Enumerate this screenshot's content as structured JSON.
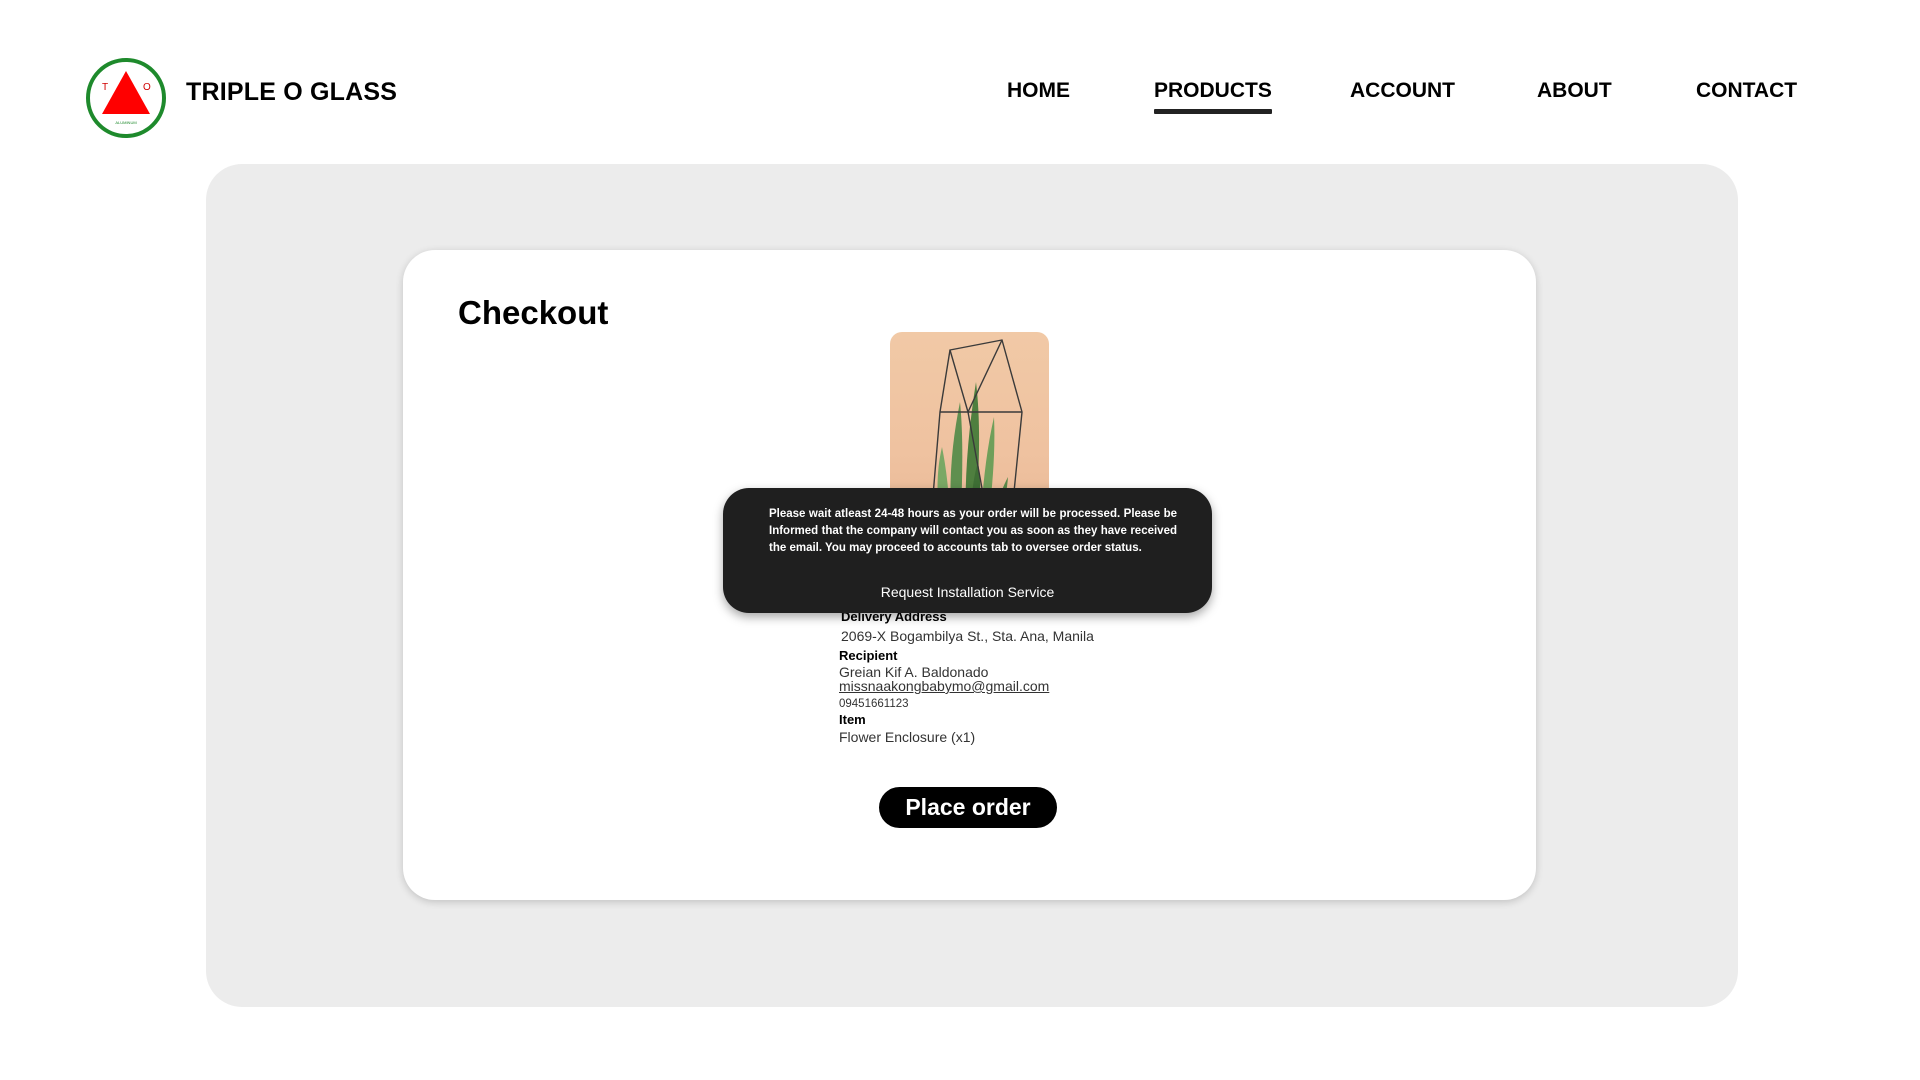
{
  "brand": {
    "name": "TRIPLE O GLASS",
    "logo_letters": [
      "T",
      "O"
    ],
    "logo_caption": "ALUMINUM",
    "colors": {
      "ring": "#1e8a2c",
      "triangle": "#ff0000"
    }
  },
  "nav": {
    "items": [
      {
        "label": "HOME",
        "active": false
      },
      {
        "label": "PRODUCTS",
        "active": true
      },
      {
        "label": "ACCOUNT",
        "active": false
      },
      {
        "label": "ABOUT",
        "active": false
      },
      {
        "label": "CONTACT",
        "active": false
      }
    ]
  },
  "checkout": {
    "title": "Checkout",
    "product_image": "flower-terrarium-image",
    "delivery_label": "Delivery Address",
    "delivery_value": "2069-X Bogambilya St., Sta. Ana, Manila",
    "recipient_label": "Recipient",
    "recipient_name": "Greian Kif A. Baldonado",
    "recipient_email": "missnaakongbabymo@gmail.com",
    "recipient_phone": "09451661123",
    "item_label": "Item",
    "item_value": "Flower Enclosure (x1)",
    "place_order_label": "Place order"
  },
  "toast": {
    "message": "Please wait atleast 24-48 hours as your order will be processed. Please be Informed that the company will contact you as soon as they have received the email. You may proceed to accounts tab to oversee order status.",
    "link_label": "Request Installation Service"
  }
}
